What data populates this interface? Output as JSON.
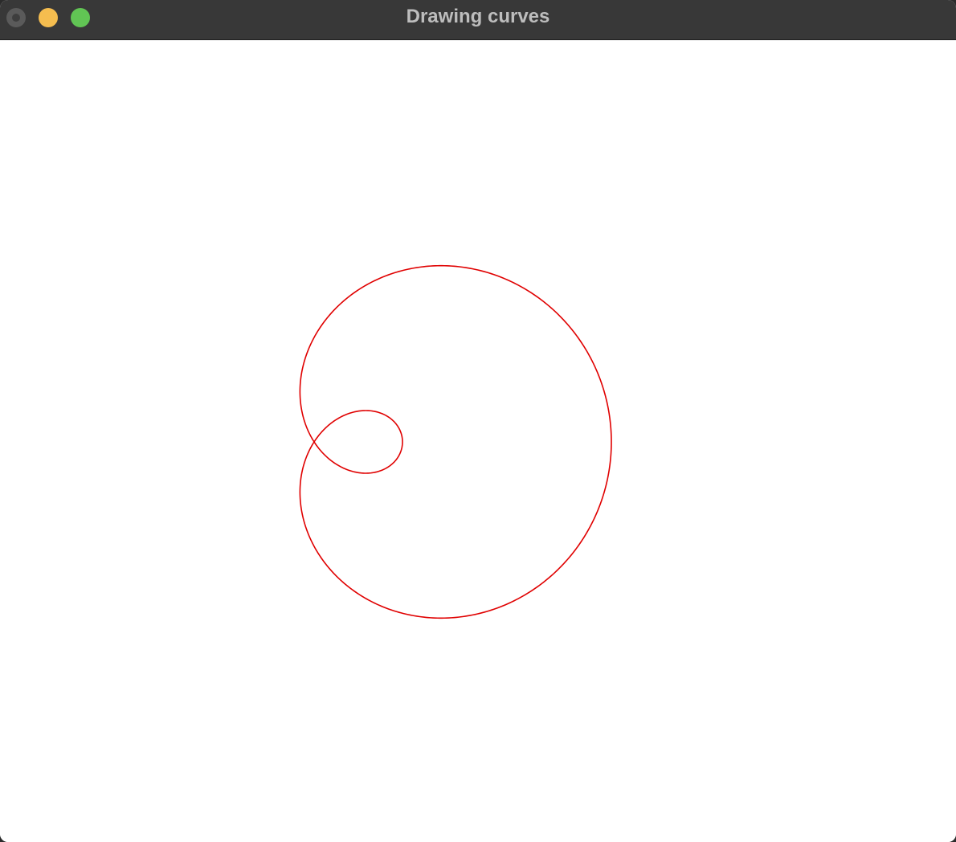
{
  "window": {
    "title": "Drawing curves",
    "controls": {
      "close": {
        "icon": "close-icon",
        "color": "#5a5a5a"
      },
      "minimize": {
        "icon": "minimize-icon",
        "color": "#f5bd4f"
      },
      "zoom": {
        "icon": "zoom-icon",
        "color": "#61c554"
      }
    }
  },
  "canvas": {
    "background": "#ffffff",
    "curve": {
      "name": "limacon-with-inner-loop",
      "color": "#e00000"
    }
  }
}
